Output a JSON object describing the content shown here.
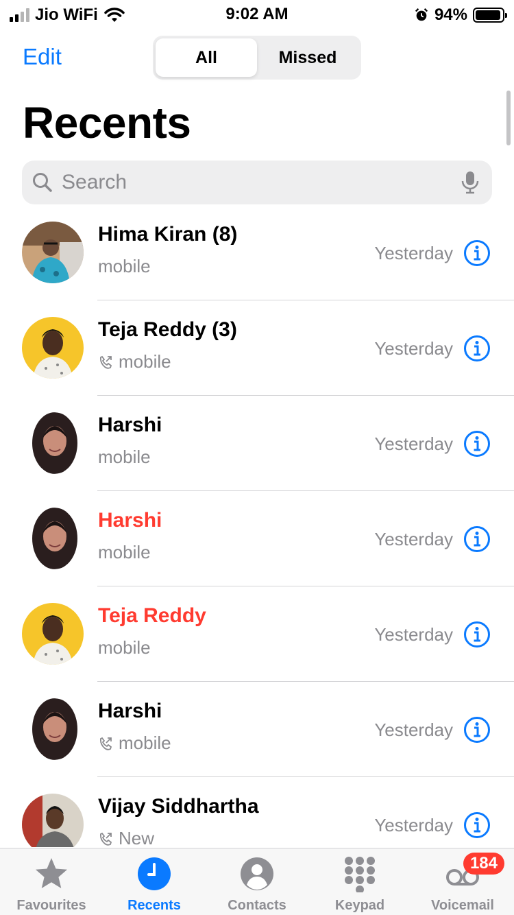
{
  "status_bar": {
    "carrier": "Jio WiFi",
    "time": "9:02 AM",
    "battery": "94%",
    "battery_level": 0.94
  },
  "header": {
    "edit_label": "Edit",
    "segments": [
      {
        "label": "All",
        "active": true
      },
      {
        "label": "Missed",
        "active": false
      }
    ],
    "title": "Recents"
  },
  "search": {
    "placeholder": "Search"
  },
  "calls": [
    {
      "name": "Hima Kiran (8)",
      "detail": "mobile",
      "time": "Yesterday",
      "missed": false,
      "outgoing": false
    },
    {
      "name": "Teja Reddy (3)",
      "detail": "mobile",
      "time": "Yesterday",
      "missed": false,
      "outgoing": true
    },
    {
      "name": "Harshi",
      "detail": "mobile",
      "time": "Yesterday",
      "missed": false,
      "outgoing": false
    },
    {
      "name": "Harshi",
      "detail": "mobile",
      "time": "Yesterday",
      "missed": true,
      "outgoing": false
    },
    {
      "name": "Teja Reddy",
      "detail": "mobile",
      "time": "Yesterday",
      "missed": true,
      "outgoing": false
    },
    {
      "name": "Harshi",
      "detail": "mobile",
      "time": "Yesterday",
      "missed": false,
      "outgoing": true
    },
    {
      "name": "Vijay Siddhartha",
      "detail": "New",
      "time": "Yesterday",
      "missed": false,
      "outgoing": true
    }
  ],
  "tabs": [
    {
      "label": "Favourites",
      "icon": "star-icon",
      "active": false
    },
    {
      "label": "Recents",
      "icon": "clock-icon",
      "active": true
    },
    {
      "label": "Contacts",
      "icon": "person-icon",
      "active": false
    },
    {
      "label": "Keypad",
      "icon": "keypad-icon",
      "active": false
    },
    {
      "label": "Voicemail",
      "icon": "voicemail-icon",
      "active": false,
      "badge": "184"
    }
  ],
  "colors": {
    "accent": "#0a7aff",
    "missed": "#ff3b30",
    "secondary_text": "#8a8a8e"
  }
}
